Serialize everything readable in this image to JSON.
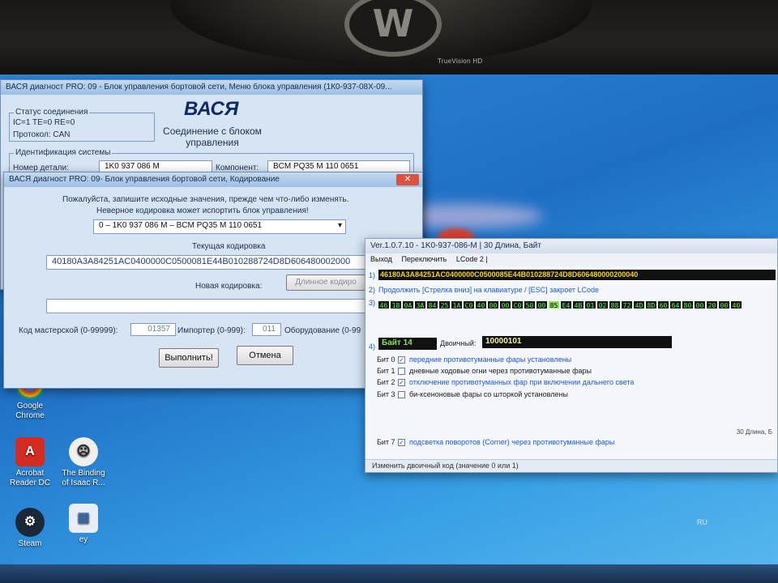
{
  "monitor": {
    "brand": "TrueVision HD"
  },
  "main_window": {
    "title": "ВАСЯ диагност PRO: 09 - Блок управления бортовой сети, Меню блока управления (1К0-937-08Х-09...",
    "logo": "ВАСЯ",
    "connection_title": "Соединение с блоком управления",
    "status_group": "Статус соединения",
    "status_line": "IC=1  TE=0   RE=0",
    "protocol": "Протокол: CAN",
    "ident_group": "Идентификация системы",
    "part_label": "Номер детали:",
    "part_value": "1K0 937 086 M",
    "component_label": "Компонент:",
    "component_value": "BCM PQ35  M    110 0651"
  },
  "coding_window": {
    "title": "ВАСЯ диагност PRO: 09- Блок управления бортовой сети, Кодирование",
    "warning_1": "Пожалуйста, запишите исходные значения, прежде чем что-либо изменять.",
    "warning_2": "Неверное кодировка может испортить блок управления!",
    "module_select": "0 – 1K0 937 086 M – BCM PQ35  M    110 0651",
    "current_label": "Текущая кодировка",
    "current_value": "40180A3A84251AC0400000C0500081E44B010288724D8D606480002000",
    "new_label": "Новая кодировка:",
    "long_coding_button": "Длинное кодиро",
    "new_value": "",
    "workshop_label": "Код мастерской (0-99999):",
    "workshop_value": "01357",
    "importer_label": "Импортер (0-999):",
    "importer_value": "011",
    "equipment_label": "Оборудование (0-99",
    "execute_button": "Выполнить!",
    "cancel_button": "Отмена"
  },
  "lcode_window": {
    "title": "Ver.1.0.7.10 -     1K0-937-086-M | 30 Длина, Байт",
    "menu": [
      "Выход",
      "Переключить",
      "LCode 2 |"
    ],
    "line1_num": "1)",
    "line1_code": "46180A3A84251AC0400000C0500085E44B010288724D8D606480000200040",
    "line2_num": "2)",
    "line2_text": "Продолжить [Стрелка вниз] на клавиатуре / [ESC] закроет LCode",
    "line3_num": "3)",
    "bytes": [
      "46",
      "18",
      "0A",
      "3A",
      "84",
      "25",
      "1A",
      "C0",
      "40",
      "00",
      "00",
      "C0",
      "50",
      "00",
      "85",
      "E4",
      "4B",
      "01",
      "02",
      "88",
      "72",
      "4D",
      "8D",
      "60",
      "64",
      "80",
      "00",
      "20",
      "00",
      "40"
    ],
    "selected_byte_index": 14,
    "line4_num": "4)",
    "byte_label": "Байт 14",
    "binary_label": "Двоичный:",
    "binary_value": "10000101",
    "bits": [
      {
        "label": "Бит 0",
        "checked": true,
        "text": "передние противотуманные фары установлены"
      },
      {
        "label": "Бит 1",
        "checked": false,
        "text": "дневные ходовые огни через противотуманные фары"
      },
      {
        "label": "Бит 2",
        "checked": true,
        "text": "отключение противотуманных фар при включении дальнего света"
      },
      {
        "label": "Бит 3",
        "checked": false,
        "text": "би-ксеноновые фары со шторкой установлены"
      }
    ],
    "bit7": {
      "label": "Бит 7",
      "checked": true,
      "text": "подсветка поворотов (Corner) через противотуманные фары"
    },
    "length_info": "30 Длина, Б",
    "status": "Изменить двоичный код (значение 0 или 1)"
  },
  "desktop": {
    "icons": [
      {
        "name": "Google Chrome",
        "label": "Google\nChrome"
      },
      {
        "name": "Acrobat Reader DC",
        "label": "Acrobat\nReader DC"
      },
      {
        "name": "The Binding of Isaac",
        "label": "The Binding\nof Isaac R..."
      },
      {
        "name": "Steam",
        "label": "Steam"
      },
      {
        "name": "ey",
        "label": "ey"
      }
    ],
    "tray_lang": "RU"
  },
  "colors": {
    "desktop": "#1e6fc5",
    "window_bg": "#d6e4f3",
    "byte_bg": "#0e1a0e",
    "byte_fg": "#77e36a",
    "selected_byte": "#8ee05c",
    "bit_on_text": "#1d58c9"
  }
}
